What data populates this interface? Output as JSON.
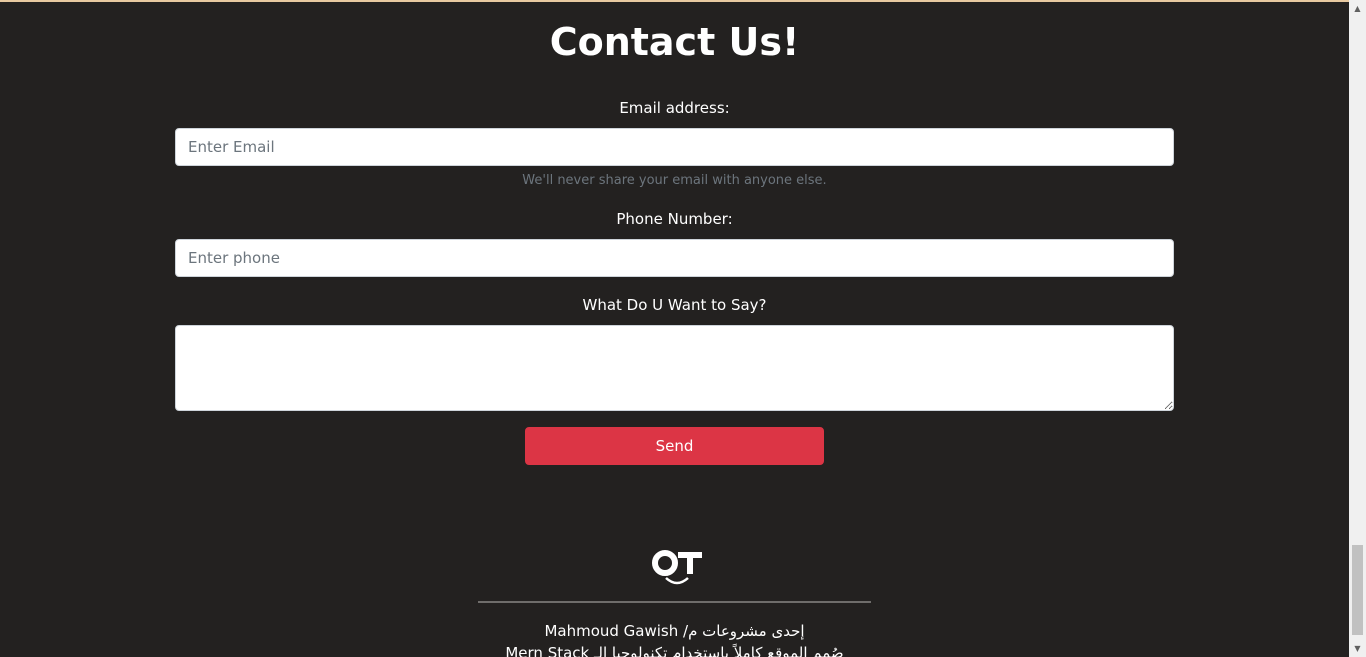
{
  "page": {
    "title": "Contact Us!"
  },
  "form": {
    "email_label": "Email address:",
    "email_placeholder": "Enter Email",
    "email_value": "",
    "email_help": "We'll never share your email with anyone else.",
    "phone_label": "Phone Number:",
    "phone_placeholder": "Enter phone",
    "phone_value": "",
    "message_label": "What Do U Want to Say?",
    "message_value": "",
    "send_label": "Send"
  },
  "footer": {
    "logo_icon": "ot-smile-logo-icon",
    "credit_line": "إحدى مشروعات م/ Mahmoud Gawish",
    "tech_line": "صُمم الموقع كاملاً باستخدام تكنولوجيا الـ Mern Stack"
  },
  "colors": {
    "background": "#232120",
    "send_button": "#dc3545",
    "top_accent": "#e8c9a0"
  }
}
